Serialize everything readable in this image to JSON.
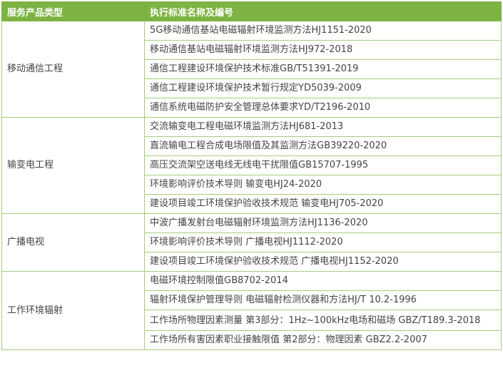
{
  "header": {
    "col_category": "服务产品类型",
    "col_standard": "执行标准名称及编号"
  },
  "categories": [
    {
      "name": "移动通信工程",
      "standards": [
        "5G移动通信基站电磁辐射环境监测方法HJ1151-2020",
        "移动通信基站电磁辐射环境监测方法HJ972-2018",
        "通信工程建设环境保护技术标准GB/T51391-2019",
        "通信工程建设环境保护技术暂行规定YD5039-2009",
        "通信系统电磁防护安全管理总体要求YD/T2196-2010"
      ]
    },
    {
      "name": "输变电工程",
      "standards": [
        "交流输变电工程电磁环境监测方法HJ681-2013",
        "直流输电工程合成电场限值及其监测方法GB39220-2020",
        "高压交流架空送电线无线电干扰限值GB15707-1995",
        "环境影响评价技术导则 输变电HJ24-2020",
        "建设项目竣工环境保护验收技术规范 输变电HJ705-2020"
      ]
    },
    {
      "name": "广播电视",
      "standards": [
        "中波广播发射台电磁辐射环境监测方法HJ1136-2020",
        "环境影响评价技术导则 广播电视HJ1112-2020",
        "建设项目竣工环境保护验收技术规范 广播电视HJ1152-2020"
      ]
    },
    {
      "name": "工作环境辐射",
      "standards": [
        "电磁环境控制限值GB8702-2014",
        "辐射环境保护管理导则 电磁辐射检测仪器和方法HJ/T 10.2-1996",
        "工作场所物理因素测量 第3部分：1Hz~100kHz电场和磁场 GBZ/T189.3-2018",
        "工作场所有害因素职业接触限值 第2部分：物理因素 GBZ2.2-2007"
      ]
    }
  ]
}
